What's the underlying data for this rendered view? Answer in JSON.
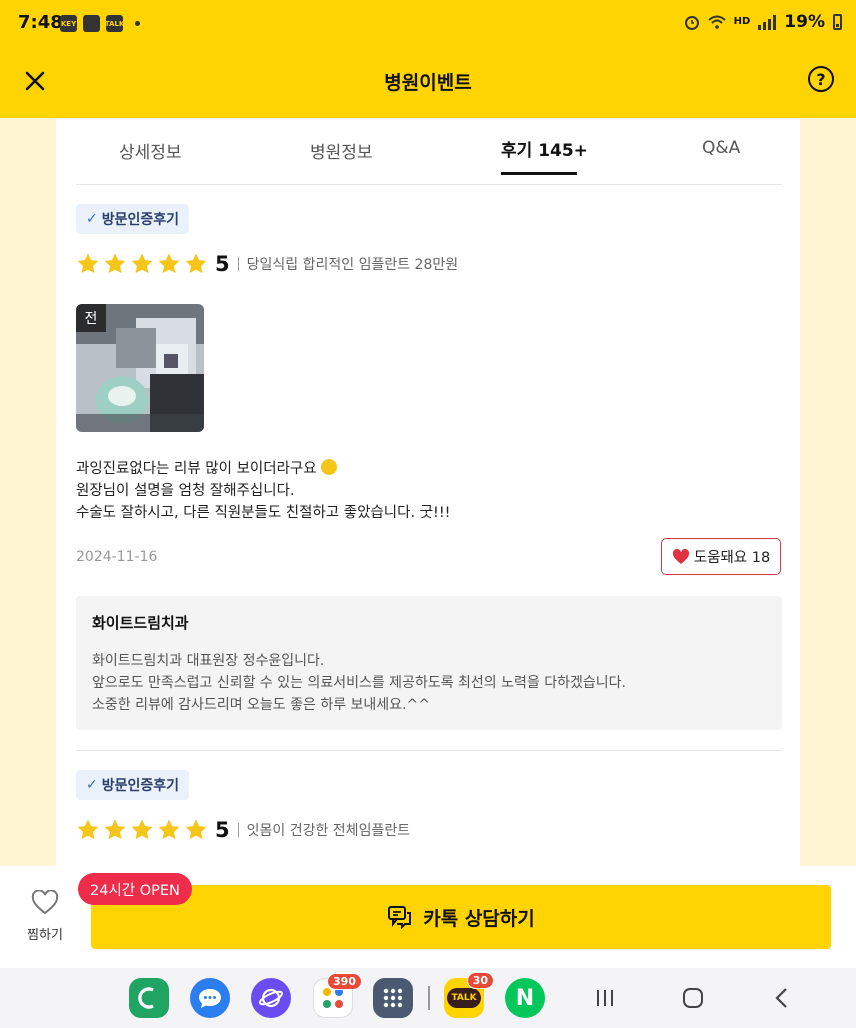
{
  "status_bar": {
    "time": "7:48",
    "battery": "19%",
    "hd_label": "HD"
  },
  "header": {
    "title": "병원이벤트"
  },
  "tabs": [
    {
      "label": "상세정보"
    },
    {
      "label": "병원정보"
    },
    {
      "label": "후기 145+",
      "active": true
    },
    {
      "label": "Q&A"
    }
  ],
  "reviews": [
    {
      "badge": "방문인증후기",
      "score": "5",
      "product": "당일식립 합리적인 임플란트 28만원",
      "photo_label": "전",
      "text_lines": [
        "과잉진료없다는 리뷰 많이 보이더라구요",
        "원장님이 설명을 엄청 잘해주십니다.",
        "수술도 잘하시고, 다른 직원분들도 친절하고 좋았습니다. 굿!!!"
      ],
      "date": "2024-11-16",
      "helpful_label": "도움돼요 18",
      "reply": {
        "name": "화이트드림치과",
        "lines": [
          "화이트드림치과 대표원장 정수윤입니다.",
          "앞으로도 만족스럽고 신뢰할 수 있는 의료서비스를 제공하도록 최선의 노력을 다하겠습니다.",
          "소중한 리뷰에 감사드리며 오늘도 좋은 하루 보내세요.^^"
        ]
      }
    },
    {
      "badge": "방문인증후기",
      "score": "5",
      "product": "잇몸이 건강한 전체임플란트"
    }
  ],
  "bottom_bar": {
    "wish_label": "찜하기",
    "open_badge": "24시간 OPEN",
    "cta_label": "카톡 상담하기"
  },
  "nav_apps": {
    "folder_badge": "390",
    "kakao_badge": "30",
    "kakao_label": "TALK",
    "naver_label": "N"
  },
  "colors": {
    "brand_yellow": "#ffd400",
    "star": "#f5c518",
    "heart": "#e0323f",
    "open_badge": "#ef2d4b"
  }
}
